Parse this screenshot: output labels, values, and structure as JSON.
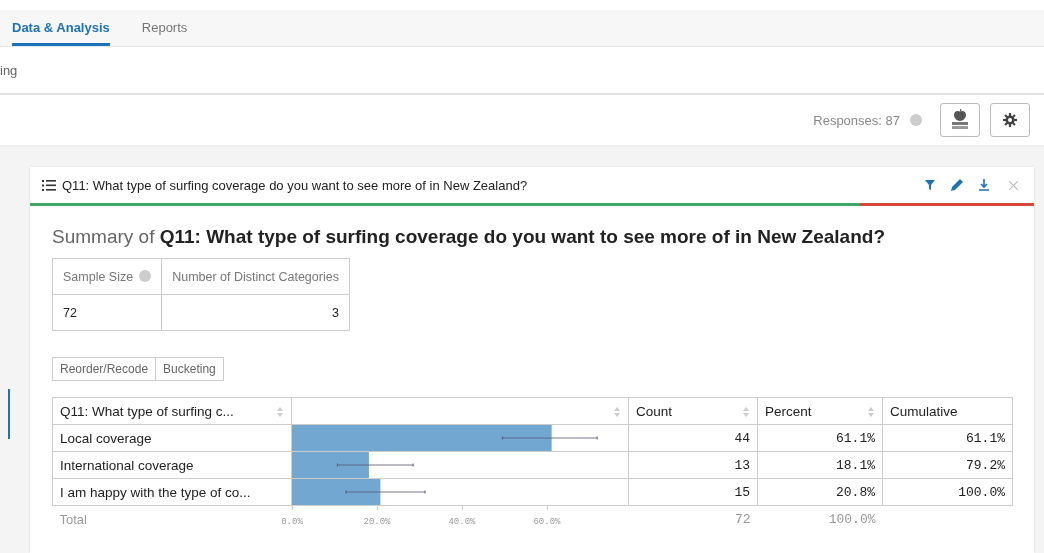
{
  "tabs": [
    {
      "label": "Data & Analysis",
      "selected": true
    },
    {
      "label": "Reports",
      "selected": false
    }
  ],
  "subnav_text": "ing",
  "toolbar": {
    "responses": "Responses: 87"
  },
  "card": {
    "title": "Q11: What type of surfing coverage do you want to see more of in New Zealand?",
    "status_bar": {
      "level": 0.827
    },
    "summary_prefix": "Summary of",
    "summary_question": "Q11: What type of surfing coverage do you want to see more of in New Zealand?",
    "stats": {
      "columns": [
        "Sample Size",
        "Number of Distinct Categories"
      ],
      "values": [
        "72",
        "3"
      ]
    },
    "actions": [
      "Reorder/Recode",
      "Bucketing"
    ],
    "table": {
      "columns": [
        "Q11: What type of surfing c...",
        "Count",
        "Percent",
        "Cumulative"
      ],
      "rows": [
        {
          "count": "44",
          "percent": "61.1%",
          "cumulative": "61.1%"
        },
        {
          "count": "13",
          "percent": "18.1%",
          "cumulative": "79.2%"
        },
        {
          "count": "15",
          "percent": "20.8%",
          "cumulative": "100.0%"
        }
      ],
      "total": {
        "label": "Total",
        "count": "72",
        "percent": "100.0%"
      },
      "chart_data": {
        "type": "bar",
        "orientation": "horizontal",
        "categories": [
          "Local coverage",
          "International coverage",
          "I am happy with the type of co..."
        ],
        "xlim": [
          0,
          79.3
        ],
        "series": [
          {
            "color": "#72a7d2",
            "values": [
              61.1,
              18.1,
              20.8
            ],
            "errors": [
              [
                49.5,
                71.8
              ],
              [
                10.7,
                28.5
              ],
              [
                12.7,
                31.3
              ]
            ]
          }
        ],
        "xticks": [
          {
            "value": 0,
            "label": "0.0%"
          },
          {
            "value": 20,
            "label": "20.0%"
          },
          {
            "value": 40,
            "label": "40.0%"
          },
          {
            "value": 60,
            "label": "60.0%"
          }
        ]
      }
    }
  }
}
